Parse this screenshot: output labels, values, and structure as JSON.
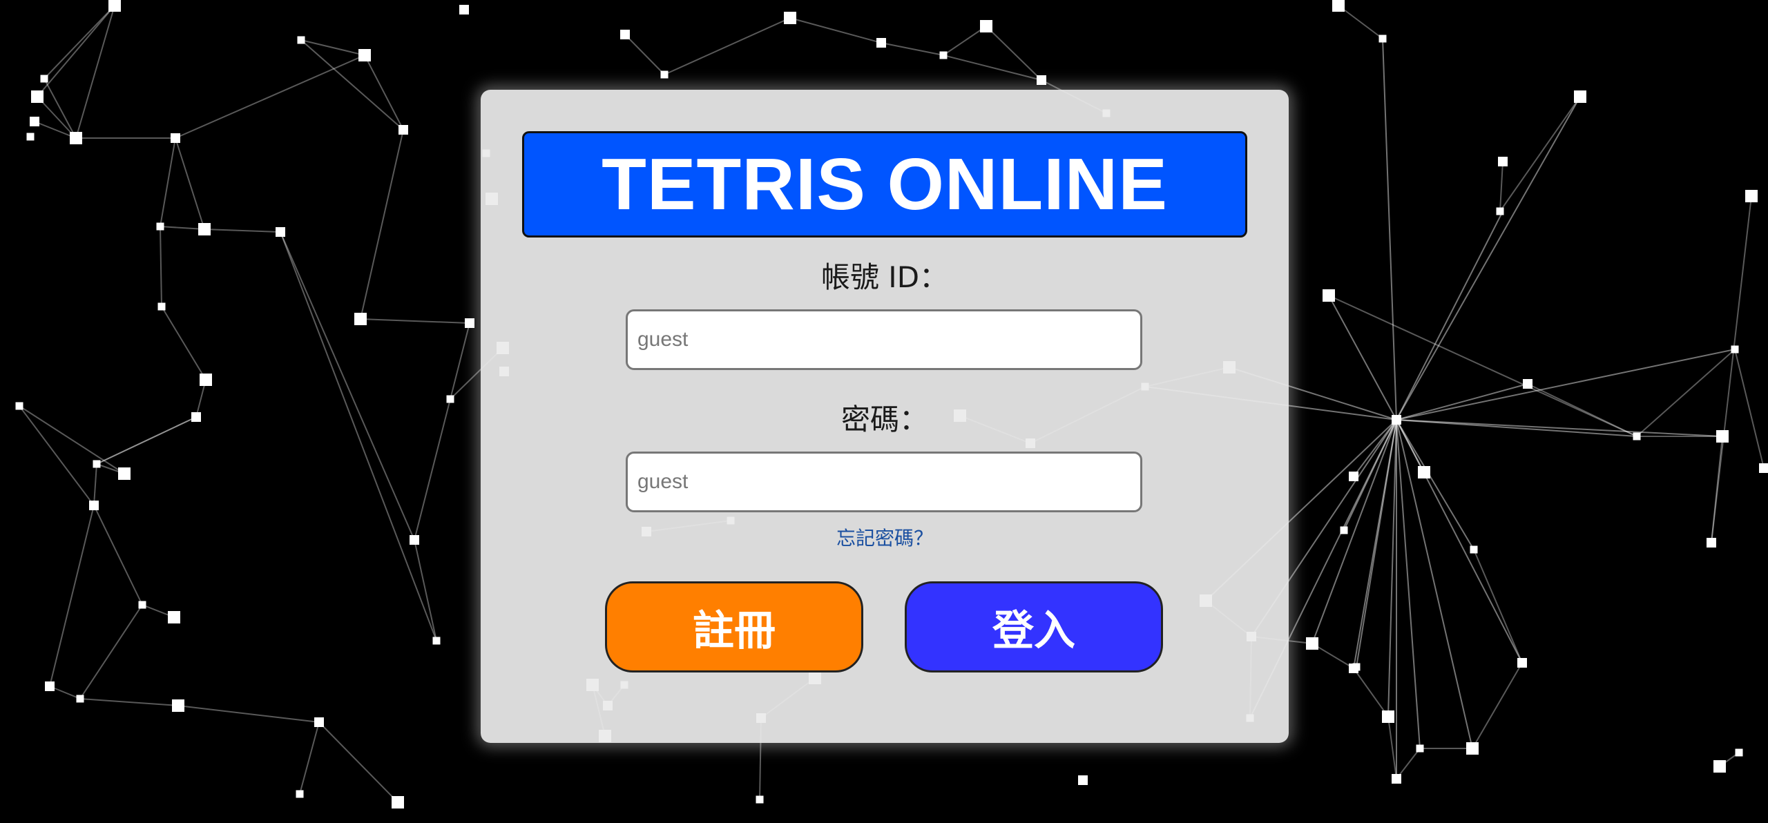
{
  "colors": {
    "background": "#000000",
    "card": "#ebebeb",
    "title_banner": "#0055ff",
    "register_button": "#ff7f00",
    "login_button": "#3333ff",
    "link": "#1a4fa0"
  },
  "login": {
    "title": "TETRIS ONLINE",
    "id_label": "帳號 ID：",
    "id_placeholder": "guest",
    "password_label": "密碼：",
    "password_placeholder": "guest",
    "forgot_password": "忘記密碼？",
    "register_label": "註冊",
    "login_label": "登入"
  }
}
